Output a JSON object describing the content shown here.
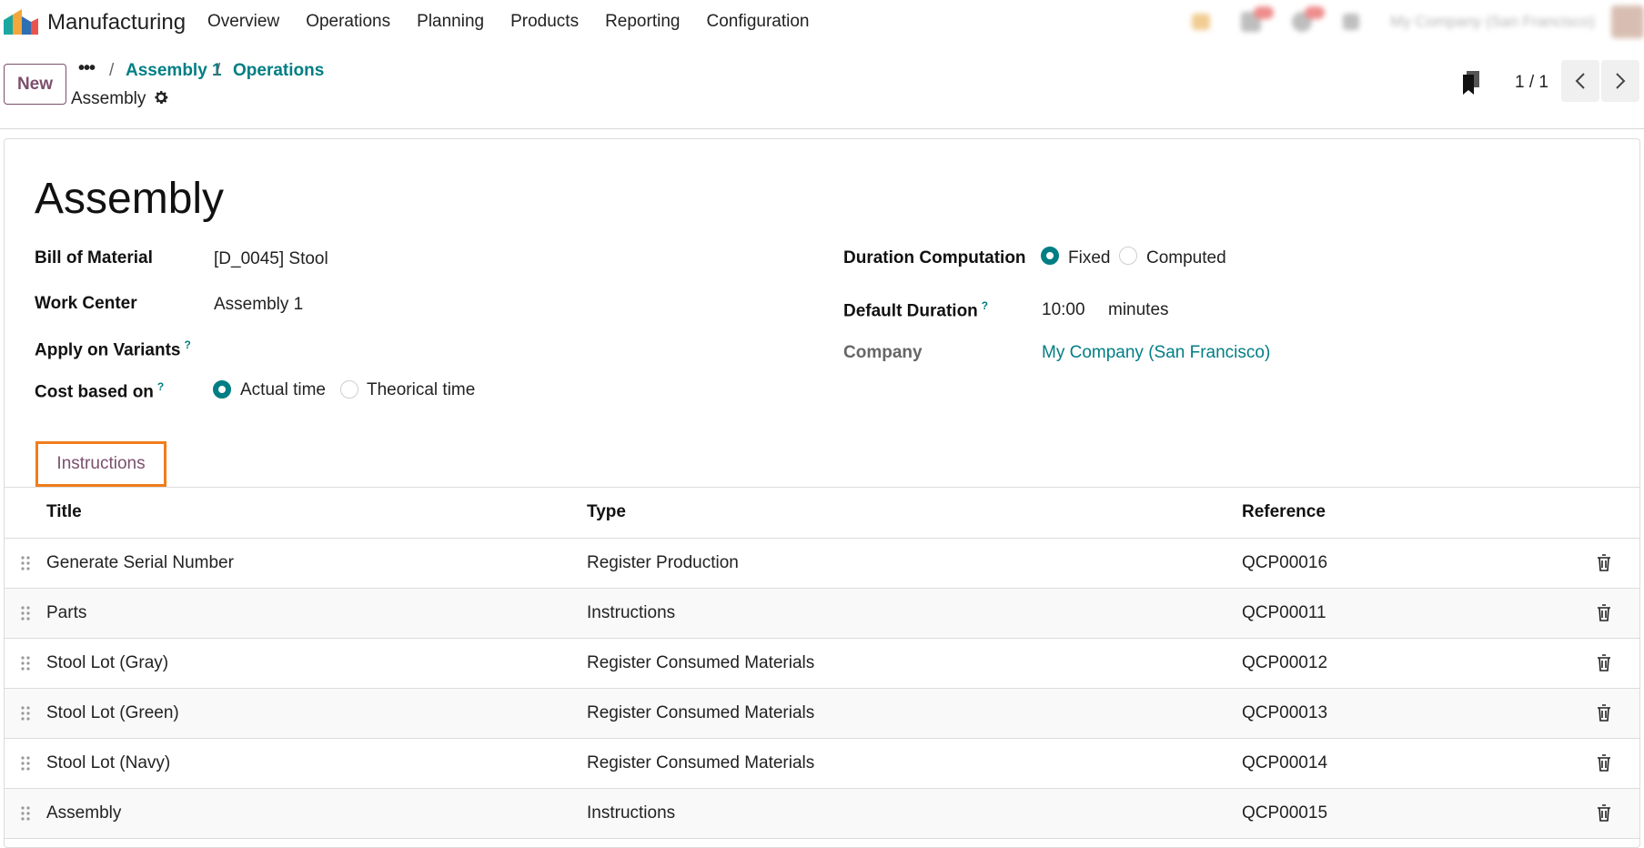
{
  "navbar": {
    "app_name": "Manufacturing",
    "menu": [
      "Overview",
      "Operations",
      "Planning",
      "Products",
      "Reporting",
      "Configuration"
    ],
    "company": "My Company (San Francisco)"
  },
  "control": {
    "new_label": "New",
    "more_label": "•••",
    "breadcrumb": [
      "Assembly 1",
      "Operations"
    ],
    "breadcrumb_sep": "/",
    "current": "Assembly",
    "pager": "1 / 1"
  },
  "form": {
    "title": "Assembly",
    "bom_label": "Bill of Material",
    "bom_value": "[D_0045] Stool",
    "workcenter_label": "Work Center",
    "workcenter_value": "Assembly 1",
    "variants_label": "Apply on Variants",
    "cost_label": "Cost based on",
    "cost_options": [
      "Actual time",
      "Theorical time"
    ],
    "cost_selected": "Actual time",
    "duration_comp_label": "Duration Computation",
    "duration_options": [
      "Fixed",
      "Computed"
    ],
    "duration_selected": "Fixed",
    "default_duration_label": "Default Duration",
    "default_duration_value": "10:00",
    "default_duration_unit": "minutes",
    "company_label": "Company",
    "company_value": "My Company (San Francisco)",
    "help_mark": "?"
  },
  "tabs": {
    "instructions": "Instructions"
  },
  "table": {
    "headers": [
      "Title",
      "Type",
      "Reference"
    ],
    "rows": [
      {
        "title": "Generate Serial Number",
        "type": "Register Production",
        "reference": "QCP00016"
      },
      {
        "title": "Parts",
        "type": "Instructions",
        "reference": "QCP00011"
      },
      {
        "title": "Stool Lot (Gray)",
        "type": "Register Consumed Materials",
        "reference": "QCP00012"
      },
      {
        "title": "Stool Lot (Green)",
        "type": "Register Consumed Materials",
        "reference": "QCP00013"
      },
      {
        "title": "Stool Lot (Navy)",
        "type": "Register Consumed Materials",
        "reference": "QCP00014"
      },
      {
        "title": "Assembly",
        "type": "Instructions",
        "reference": "QCP00015"
      }
    ]
  },
  "colors": {
    "accent": "#017e84",
    "brand": "#7c4f6d",
    "highlight": "#f07d1b"
  }
}
